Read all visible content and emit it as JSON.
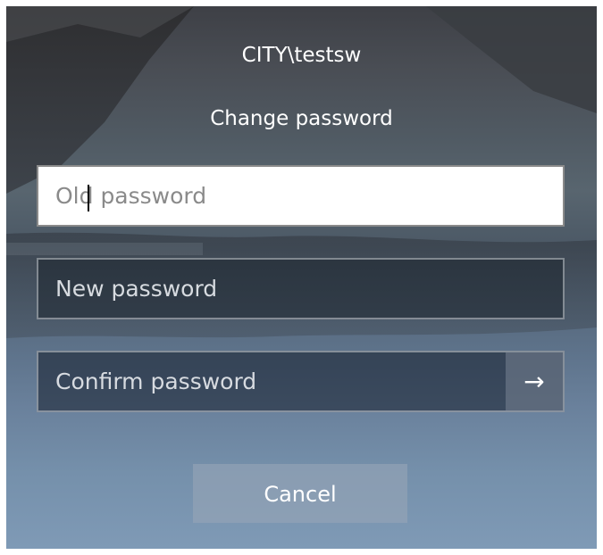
{
  "account": {
    "username": "CITY\\testsw"
  },
  "dialog": {
    "title": "Change password"
  },
  "fields": {
    "old_password": {
      "value": "",
      "placeholder": "Old password"
    },
    "new_password": {
      "value": "",
      "placeholder": "New password"
    },
    "confirm_password": {
      "value": "",
      "placeholder": "Confirm password"
    }
  },
  "submit": {
    "icon": "arrow-right-icon",
    "glyph": "→"
  },
  "buttons": {
    "cancel_label": "Cancel"
  },
  "colors": {
    "text": "#ffffff",
    "active_field_bg": "#ffffff",
    "placeholder_dark": "#8a8a8a"
  }
}
